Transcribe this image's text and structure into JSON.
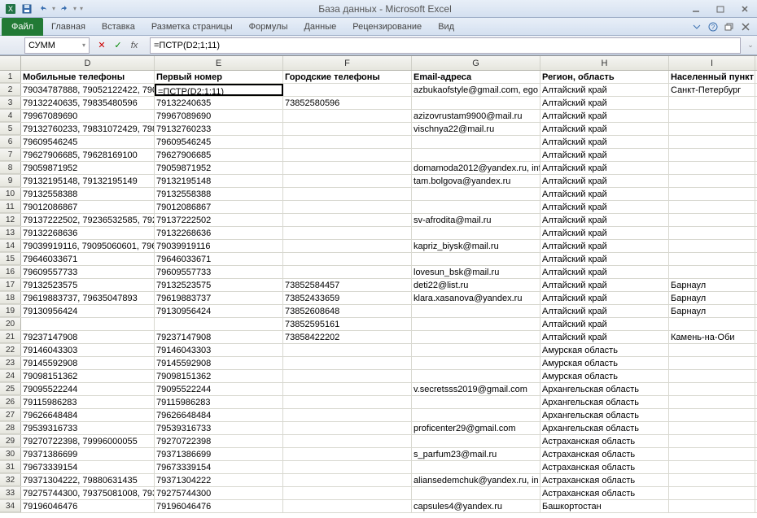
{
  "window": {
    "title": "База данных - Microsoft Excel"
  },
  "qat": {
    "save": "save-icon",
    "undo": "undo-icon",
    "redo": "redo-icon"
  },
  "ribbon": {
    "file": "Файл",
    "tabs": [
      "Главная",
      "Вставка",
      "Разметка страницы",
      "Формулы",
      "Данные",
      "Рецензирование",
      "Вид"
    ]
  },
  "namebox": {
    "value": "СУММ"
  },
  "formula_bar": {
    "cancel": "✕",
    "confirm": "✓",
    "fx": "fx",
    "value": "=ПСТР(D2;1;11)"
  },
  "columns": [
    "D",
    "E",
    "F",
    "G",
    "H",
    "I"
  ],
  "header_row": {
    "n": "1",
    "D": "Мобильные телефоны",
    "E": "Первый номер",
    "F": "Городские телефоны",
    "G": "Email-адреса",
    "H": "Регион, область",
    "I": "Населенный пункт"
  },
  "rows": [
    {
      "n": "2",
      "D": "79034787888, 79052122422, 7906",
      "E": "=ПСТР(D2;1;11)",
      "F": "",
      "G": "azbukaofstyle@gmail.com, ego",
      "H": "Алтайский край",
      "I": "Санкт-Петербург",
      "ed": true
    },
    {
      "n": "3",
      "D": "79132240635, 79835480596",
      "E": "79132240635",
      "F": "73852580596",
      "G": "",
      "H": "Алтайский край",
      "I": ""
    },
    {
      "n": "4",
      "D": "79967089690",
      "E": "79967089690",
      "F": "",
      "G": "azizovrustam9900@mail.ru",
      "H": "Алтайский край",
      "I": ""
    },
    {
      "n": "5",
      "D": "79132760233, 79831072429, 7983",
      "E": "79132760233",
      "F": "",
      "G": "vischnya22@mail.ru",
      "H": "Алтайский край",
      "I": ""
    },
    {
      "n": "6",
      "D": "79609546245",
      "E": "79609546245",
      "F": "",
      "G": "",
      "H": "Алтайский край",
      "I": ""
    },
    {
      "n": "7",
      "D": "79627906685, 79628169100",
      "E": "79627906685",
      "F": "",
      "G": "",
      "H": "Алтайский край",
      "I": ""
    },
    {
      "n": "8",
      "D": "79059871952",
      "E": "79059871952",
      "F": "",
      "G": "domamoda2012@yandex.ru, inf",
      "H": "Алтайский край",
      "I": ""
    },
    {
      "n": "9",
      "D": "79132195148, 79132195149",
      "E": "79132195148",
      "F": "",
      "G": "tam.bolgova@yandex.ru",
      "H": "Алтайский край",
      "I": ""
    },
    {
      "n": "10",
      "D": "79132558388",
      "E": "79132558388",
      "F": "",
      "G": "",
      "H": "Алтайский край",
      "I": ""
    },
    {
      "n": "11",
      "D": "79012086867",
      "E": "79012086867",
      "F": "",
      "G": "",
      "H": "Алтайский край",
      "I": ""
    },
    {
      "n": "12",
      "D": "79137222502, 79236532585, 7923",
      "E": "79137222502",
      "F": "",
      "G": "sv-afrodita@mail.ru",
      "H": "Алтайский край",
      "I": ""
    },
    {
      "n": "13",
      "D": "79132268636",
      "E": "79132268636",
      "F": "",
      "G": "",
      "H": "Алтайский край",
      "I": ""
    },
    {
      "n": "14",
      "D": "79039919116, 79095060601, 7963",
      "E": "79039919116",
      "F": "",
      "G": "kapriz_biysk@mail.ru",
      "H": "Алтайский край",
      "I": ""
    },
    {
      "n": "15",
      "D": "79646033671",
      "E": "79646033671",
      "F": "",
      "G": "",
      "H": "Алтайский край",
      "I": ""
    },
    {
      "n": "16",
      "D": "79609557733",
      "E": "79609557733",
      "F": "",
      "G": "lovesun_bsk@mail.ru",
      "H": "Алтайский край",
      "I": ""
    },
    {
      "n": "17",
      "D": "79132523575",
      "E": "79132523575",
      "F": "73852584457",
      "G": "deti22@list.ru",
      "H": "Алтайский край",
      "I": "Барнаул"
    },
    {
      "n": "18",
      "D": "79619883737, 79635047893",
      "E": "79619883737",
      "F": "73852433659",
      "G": "klara.xasanova@yandex.ru",
      "H": "Алтайский край",
      "I": "Барнаул"
    },
    {
      "n": "19",
      "D": "79130956424",
      "E": "79130956424",
      "F": "73852608648",
      "G": "",
      "H": "Алтайский край",
      "I": "Барнаул"
    },
    {
      "n": "20",
      "D": "",
      "E": "",
      "F": "73852595161",
      "G": "",
      "H": "Алтайский край",
      "I": ""
    },
    {
      "n": "21",
      "D": "79237147908",
      "E": "79237147908",
      "F": "73858422202",
      "G": "",
      "H": "Алтайский край",
      "I": "Камень-на-Оби"
    },
    {
      "n": "22",
      "D": "79146043303",
      "E": "79146043303",
      "F": "",
      "G": "",
      "H": "Амурская область",
      "I": ""
    },
    {
      "n": "23",
      "D": "79145592908",
      "E": "79145592908",
      "F": "",
      "G": "",
      "H": "Амурская область",
      "I": ""
    },
    {
      "n": "24",
      "D": "79098151362",
      "E": "79098151362",
      "F": "",
      "G": "",
      "H": "Амурская область",
      "I": ""
    },
    {
      "n": "25",
      "D": "79095522244",
      "E": "79095522244",
      "F": "",
      "G": "v.secretsss2019@gmail.com",
      "H": "Архангельская область",
      "I": ""
    },
    {
      "n": "26",
      "D": "79115986283",
      "E": "79115986283",
      "F": "",
      "G": "",
      "H": "Архангельская область",
      "I": ""
    },
    {
      "n": "27",
      "D": "79626648484",
      "E": "79626648484",
      "F": "",
      "G": "",
      "H": "Архангельская область",
      "I": ""
    },
    {
      "n": "28",
      "D": "79539316733",
      "E": "79539316733",
      "F": "",
      "G": "proficenter29@gmail.com",
      "H": "Архангельская область",
      "I": ""
    },
    {
      "n": "29",
      "D": "79270722398, 79996000055",
      "E": "79270722398",
      "F": "",
      "G": "",
      "H": "Астраханская область",
      "I": ""
    },
    {
      "n": "30",
      "D": "79371386699",
      "E": "79371386699",
      "F": "",
      "G": "s_parfum23@mail.ru",
      "H": "Астраханская область",
      "I": ""
    },
    {
      "n": "31",
      "D": "79673339154",
      "E": "79673339154",
      "F": "",
      "G": "",
      "H": "Астраханская область",
      "I": ""
    },
    {
      "n": "32",
      "D": "79371304222, 79880631435",
      "E": "79371304222",
      "F": "",
      "G": "aliansedemchuk@yandex.ru, in",
      "H": "Астраханская область",
      "I": ""
    },
    {
      "n": "33",
      "D": "79275744300, 79375081008, 7937",
      "E": "79275744300",
      "F": "",
      "G": "",
      "H": "Астраханская область",
      "I": ""
    },
    {
      "n": "34",
      "D": "79196046476",
      "E": "79196046476",
      "F": "",
      "G": "capsules4@yandex.ru",
      "H": "Башкортостан",
      "I": ""
    }
  ]
}
